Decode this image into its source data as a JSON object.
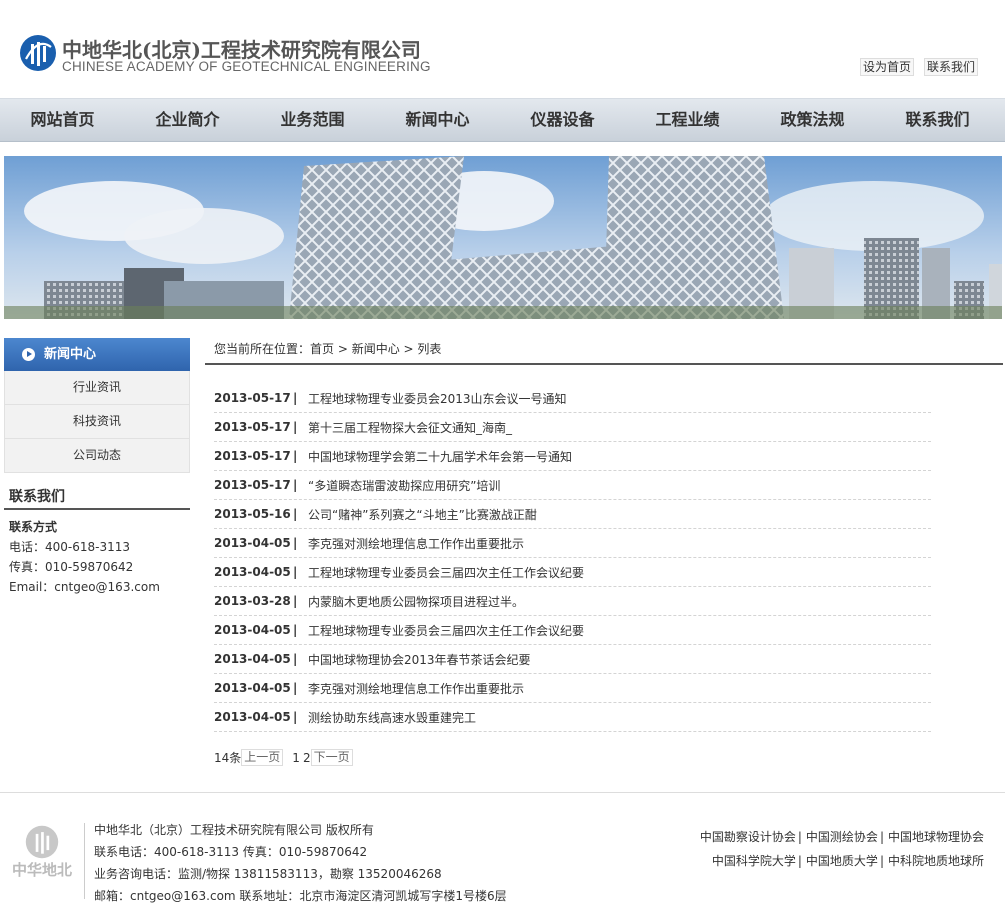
{
  "header": {
    "logo_cn": "中地华北(北京)工程技术研究院有限公司",
    "logo_en": "CHINESE ACADEMY OF GEOTECHNICAL ENGINEERING",
    "set_home": "设为首页",
    "contact_us": "联系我们"
  },
  "nav": [
    "网站首页",
    "企业简介",
    "业务范围",
    "新闻中心",
    "仪器设备",
    "工程业绩",
    "政策法规",
    "联系我们"
  ],
  "sidebar": {
    "head": "新闻中心",
    "items": [
      "行业资讯",
      "科技资讯",
      "公司动态"
    ],
    "contact_title": "联系我们",
    "contact_sub": "联系方式",
    "phone": "电话：400-618-3113",
    "fax": "传真：010-59870642",
    "email": "Email：cntgeo@163.com"
  },
  "breadcrumb": {
    "prefix": "您当前所在位置：",
    "home": "首页",
    "sep1": " > ",
    "section": "新闻中心",
    "sep2": " > ",
    "current": "列表"
  },
  "news": [
    {
      "date": "2013-05-17",
      "sep": "|",
      "title": "工程地球物理专业委员会2013山东会议一号通知"
    },
    {
      "date": "2013-05-17",
      "sep": "|",
      "title": "第十三届工程物探大会征文通知_海南_"
    },
    {
      "date": "2013-05-17",
      "sep": "|",
      "title": "中国地球物理学会第二十九届学术年会第一号通知"
    },
    {
      "date": "2013-05-17",
      "sep": "|",
      "title": "“多道瞬态瑞雷波勘探应用研究”培训"
    },
    {
      "date": "2013-05-16",
      "sep": "|",
      "title": "公司“赌神”系列赛之“斗地主”比赛激战正酣"
    },
    {
      "date": "2013-04-05",
      "sep": "|",
      "title": "李克强对测绘地理信息工作作出重要批示"
    },
    {
      "date": "2013-04-05",
      "sep": "|",
      "title": "工程地球物理专业委员会三届四次主任工作会议纪要"
    },
    {
      "date": "2013-03-28",
      "sep": "|",
      "title": "内蒙脑木更地质公园物探项目进程过半。"
    },
    {
      "date": "2013-04-05",
      "sep": "|",
      "title": "工程地球物理专业委员会三届四次主任工作会议纪要"
    },
    {
      "date": "2013-04-05",
      "sep": "|",
      "title": "中国地球物理协会2013年春节茶话会纪要"
    },
    {
      "date": "2013-04-05",
      "sep": "|",
      "title": "李克强对测绘地理信息工作作出重要批示"
    },
    {
      "date": "2013-04-05",
      "sep": "|",
      "title": "测绘协助东线高速水毁重建完工"
    }
  ],
  "pager": {
    "count": "14条",
    "prev": "上一页",
    "page1": "1",
    "page2": "2",
    "next": "下一页"
  },
  "footer": {
    "logo_text": "中华地北",
    "line1": "中地华北（北京）工程技术研究院有限公司 版权所有",
    "line2": "联系电话：400-618-3113 传真：010-59870642",
    "line3": "业务咨询电话：监测/物探 13811583113，勘察 13520046268",
    "line4": "邮箱：cntgeo@163.com 联系地址：北京市海淀区清河凯城写字楼1号楼6层",
    "links_row1": [
      "中国勘察设计协会",
      "中国测绘协会",
      "中国地球物理协会"
    ],
    "links_row2": [
      "中国科学院大学",
      "中国地质大学",
      "中科院地质地球所"
    ],
    "sep": "|"
  },
  "colors": {
    "nav_bg": "#cfd6de",
    "side_head": "#3a72bd",
    "logo_blue": "#1a5fae",
    "rule": "#555555"
  }
}
